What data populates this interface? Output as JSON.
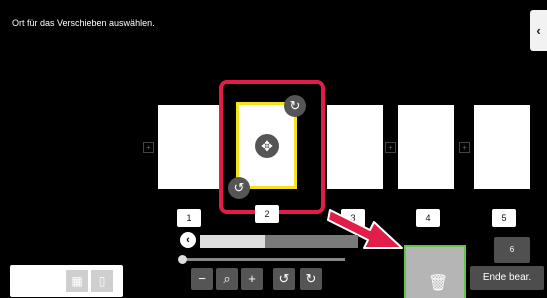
{
  "instruction": "Ort für das Verschieben auswählen.",
  "side_toggle_icon": "chevron-left-icon",
  "side_toggle_glyph": "‹",
  "pages": [
    {
      "label": "1"
    },
    {
      "label": "2"
    },
    {
      "label": "3"
    },
    {
      "label": "4"
    },
    {
      "label": "5"
    },
    {
      "label": "6"
    }
  ],
  "selected_page": {
    "rotate_cw_icon": "rotate-cw-icon",
    "rotate_ccw_icon": "rotate-ccw-icon",
    "move_icon": "move-icon",
    "rotate_cw_glyph": "↻",
    "rotate_ccw_glyph": "↺",
    "move_glyph": "✥"
  },
  "insert_glyph": "+",
  "scroll_left_glyph": "‹",
  "zoom": {
    "minus_glyph": "−",
    "search_glyph": "⌕",
    "plus_glyph": "+",
    "rotate_ccw_glyph": "↺",
    "rotate_cw_glyph": "↻"
  },
  "trash_glyph": "🗑",
  "end_edit_label": "Ende bear.",
  "colors": {
    "selection_frame": "#e11d48",
    "selected_page_border": "#f4e11f",
    "trash_border": "#63c34a",
    "arrow": "#e11d48"
  }
}
